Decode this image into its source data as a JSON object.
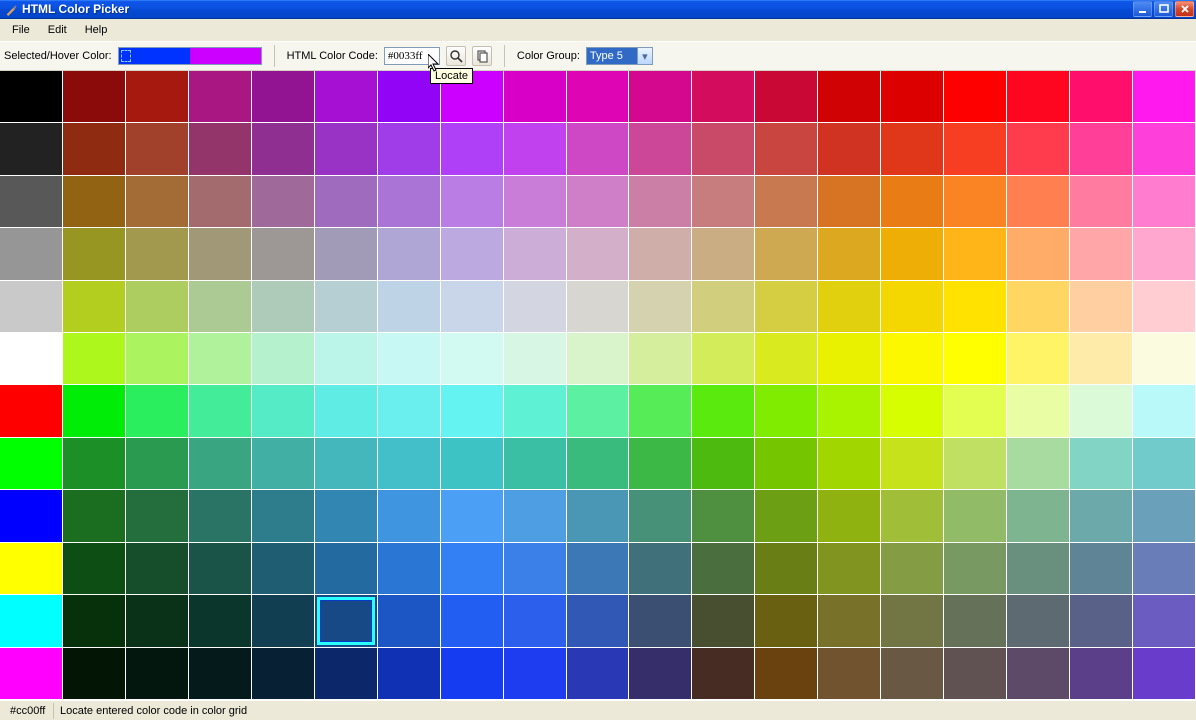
{
  "title": "HTML Color Picker",
  "menu": {
    "file": "File",
    "edit": "Edit",
    "help": "Help"
  },
  "toolbar": {
    "selected_label": "Selected/Hover Color:",
    "selected_color": "#0033ff",
    "hover_color": "#cc00ff",
    "code_label": "HTML Color Code:",
    "code_value": "#0033ff",
    "group_label": "Color Group:",
    "group_value": "Type 5",
    "locate_tooltip": "Locate"
  },
  "status": {
    "code": "#cc00ff",
    "hint": "Locate entered color code in color grid"
  },
  "grid": {
    "selected_index": 195,
    "rows": [
      [
        "#000000",
        "#8b0b0b",
        "#a6190e",
        "#a91882",
        "#921493",
        "#a510d2",
        "#9104f5",
        "#cc00ff",
        "#d800c7",
        "#de05b5",
        "#d3088e",
        "#d30c5e",
        "#c90836",
        "#d00204",
        "#dd0000",
        "#ff0000",
        "#ff0620",
        "#ff0f6b",
        "#ff19ef"
      ],
      [
        "#222222",
        "#8e2b10",
        "#a1402b",
        "#93346a",
        "#8e2f91",
        "#9833c5",
        "#a03de8",
        "#b040f7",
        "#c241ee",
        "#ce48c5",
        "#cc4797",
        "#c94969",
        "#c84540",
        "#d03322",
        "#e03619",
        "#f83e22",
        "#ff3c4d",
        "#ff3f98",
        "#ff3fda"
      ],
      [
        "#585858",
        "#926313",
        "#a36b36",
        "#a36b6d",
        "#9f6a99",
        "#9f6bbe",
        "#a974d6",
        "#b97de3",
        "#c97dd8",
        "#ce7fc7",
        "#cb7fa6",
        "#c77d7e",
        "#c97950",
        "#d77423",
        "#e97c14",
        "#fa8423",
        "#ff7f51",
        "#ff7ca0",
        "#ff7cce"
      ],
      [
        "#969696",
        "#979622",
        "#a2994e",
        "#a09877",
        "#9d9796",
        "#a29bb8",
        "#afa6d5",
        "#bca9e0",
        "#ccadd7",
        "#d3afca",
        "#cfaea9",
        "#cbad84",
        "#cfa951",
        "#dca81f",
        "#efae05",
        "#ffb517",
        "#ffac68",
        "#ffa7a8",
        "#ffa7ce"
      ],
      [
        "#c9c9c9",
        "#b3ce1f",
        "#aecd60",
        "#acca93",
        "#adcbb8",
        "#b5cfd3",
        "#bed4e6",
        "#c9d6ea",
        "#d3d6e1",
        "#d8d6d1",
        "#d5d3af",
        "#d1cf7e",
        "#d6ce42",
        "#e1d00d",
        "#f4d700",
        "#ffe200",
        "#ffd662",
        "#ffcfa2",
        "#ffcdd2"
      ],
      [
        "#ffffff",
        "#aef71d",
        "#acf360",
        "#b0f19b",
        "#b6f1ce",
        "#bbf5e9",
        "#c8f8f3",
        "#d2faf3",
        "#d7f6e3",
        "#d9f4cb",
        "#d4ee9d",
        "#d2ec5a",
        "#d9eb1f",
        "#e9f000",
        "#fbf800",
        "#ffff00",
        "#fff366",
        "#ffeba9",
        "#fbfbe0"
      ],
      [
        "#ff0000",
        "#00ed07",
        "#2aee5d",
        "#42ec98",
        "#54ebc6",
        "#5eece4",
        "#6befee",
        "#64f3f0",
        "#5ff1d3",
        "#5bf0a2",
        "#55ec58",
        "#5aea0d",
        "#80ed00",
        "#a9f300",
        "#d6fe00",
        "#e3fe50",
        "#e9fda4",
        "#dbfad7",
        "#baf9f9"
      ],
      [
        "#00ff00",
        "#1c9026",
        "#2a9a50",
        "#39a581",
        "#41afa4",
        "#44b7bd",
        "#43bfc9",
        "#3ec3c4",
        "#3abfa5",
        "#38bb7c",
        "#3bb845",
        "#4cba0e",
        "#75c600",
        "#a2d600",
        "#c5e21a",
        "#bfe063",
        "#a8db9f",
        "#82d4c4",
        "#71cbcb"
      ],
      [
        "#0000ff",
        "#1b6e1f",
        "#246d3c",
        "#2a7465",
        "#2e7d8c",
        "#3287b2",
        "#4095e0",
        "#4b9ff5",
        "#4e9ee4",
        "#4997b4",
        "#479179",
        "#4e8f40",
        "#6d9f14",
        "#8fb210",
        "#a0be38",
        "#92bb68",
        "#7eb48f",
        "#6ba9ab",
        "#6ba0ba"
      ],
      [
        "#ffff00",
        "#0d4e14",
        "#164e2c",
        "#1a5449",
        "#1f5e72",
        "#236aa1",
        "#2a76d5",
        "#3380f4",
        "#3b7fe9",
        "#3d78b6",
        "#40707a",
        "#4a6e3d",
        "#697f16",
        "#829420",
        "#849c44",
        "#789a62",
        "#698f7e",
        "#5e8495",
        "#697eb9"
      ],
      [
        "#00ffff",
        "#06310b",
        "#093218",
        "#0b362c",
        "#113f51",
        "#164985",
        "#1c56c4",
        "#225ef2",
        "#2c60ec",
        "#3158b4",
        "#3a4f71",
        "#484e30",
        "#696012",
        "#78712a",
        "#727645",
        "#66715a",
        "#5e6a71",
        "#596188",
        "#6a5cc1"
      ],
      [
        "#ff00ff",
        "#031606",
        "#03170e",
        "#051a1b",
        "#082034",
        "#0c286a",
        "#1131b5",
        "#153cf1",
        "#1e3df0",
        "#2938b4",
        "#362e6b",
        "#472c24",
        "#6a4210",
        "#71542f",
        "#695844",
        "#605253",
        "#5c4a68",
        "#5b4089",
        "#693ccb"
      ]
    ]
  }
}
